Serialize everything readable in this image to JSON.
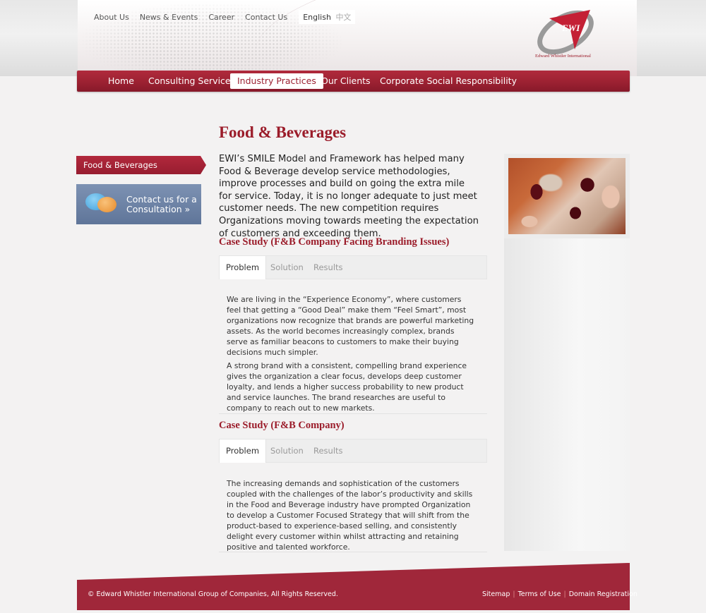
{
  "header": {
    "top_links": [
      "About Us",
      "News & Events",
      "Career",
      "Contact Us"
    ],
    "lang_en": "English",
    "lang_zh": "中文",
    "logo_text": "EWI",
    "logo_caption": "Edward Whistler International"
  },
  "nav": {
    "items": [
      "Home",
      "Consulting Services",
      "Industry Practices",
      "Our Clients",
      "Corporate Social Responsibility"
    ],
    "active": "Industry Practices"
  },
  "sidebar": {
    "tab_label": "Food & Beverages",
    "contact_line1": "Contact us for a",
    "contact_line2": "Consultation »"
  },
  "main": {
    "title": "Food & Beverages",
    "intro": "EWI’s SMILE Model and Framework has helped many Food & Beverage develop service methodologies, improve processes and build on going the extra mile for service. Today, it is no longer adequate to just meet customer needs. The new competition requires Organizations moving towards meeting the expectation of customers and exceeding them.",
    "case1": {
      "title": "Case Study (F&B Company Facing Branding Issues)",
      "tabs": [
        "Problem",
        "Solution",
        "Results"
      ],
      "para1": "We are living in the “Experience Economy”, where customers feel that getting a “Good Deal” make them “Feel Smart”, most organizations now recognize that brands are powerful marketing assets. As the world becomes increasingly complex, brands serve as familiar beacons to customers to make their buying decisions much simpler.",
      "para2": "A strong brand with a consistent, compelling brand experience gives the organization a clear focus, develops deep customer loyalty, and lends a higher success probability to new product and service launches. The brand researches are useful to company to reach out to new markets."
    },
    "case2": {
      "title": "Case Study (F&B Company)",
      "tabs": [
        "Problem",
        "Solution",
        "Results"
      ],
      "para1": "The increasing demands and sophistication of the customers coupled with the challenges of the labor’s productivity and skills in the Food and Beverage industry have prompted Organization to develop a Customer Focused Strategy that will shift from the product-based to experience-based selling, and consistently delight every customer within whilst attracting and retaining positive and talented workforce."
    }
  },
  "footer": {
    "copyright": "© Edward Whistler International Group of Companies, All Rights Reserved.",
    "links": [
      "Sitemap",
      "Terms of Use",
      "Domain Registration"
    ]
  },
  "colors": {
    "brand_red": "#9b1c2a",
    "nav_red": "#9c2132",
    "contact_blue": "#6b80a5"
  }
}
